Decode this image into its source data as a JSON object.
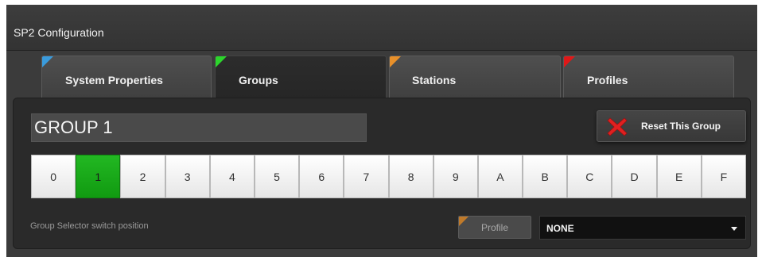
{
  "window": {
    "title": "SP2 Configuration"
  },
  "tabs": [
    {
      "label": "System Properties",
      "corner_color": "#3a9bdc",
      "active": false
    },
    {
      "label": "Groups",
      "corner_color": "#2cd52c",
      "active": true
    },
    {
      "label": "Stations",
      "corner_color": "#e8902a",
      "active": false
    },
    {
      "label": "Profiles",
      "corner_color": "#e01818",
      "active": false
    }
  ],
  "group": {
    "name": "GROUP 1",
    "reset_label": "Reset This Group",
    "reset_icon": "x-icon",
    "reset_icon_color": "#e02020"
  },
  "switch": {
    "positions": [
      "0",
      "1",
      "2",
      "3",
      "4",
      "5",
      "6",
      "7",
      "8",
      "9",
      "A",
      "B",
      "C",
      "D",
      "E",
      "F"
    ],
    "selected": "1",
    "selected_color": "#1aab1a",
    "footer_label": "Group Selector switch position"
  },
  "profile": {
    "button_label": "Profile",
    "corner_color": "#c07a2a",
    "selected_value": "NONE"
  }
}
